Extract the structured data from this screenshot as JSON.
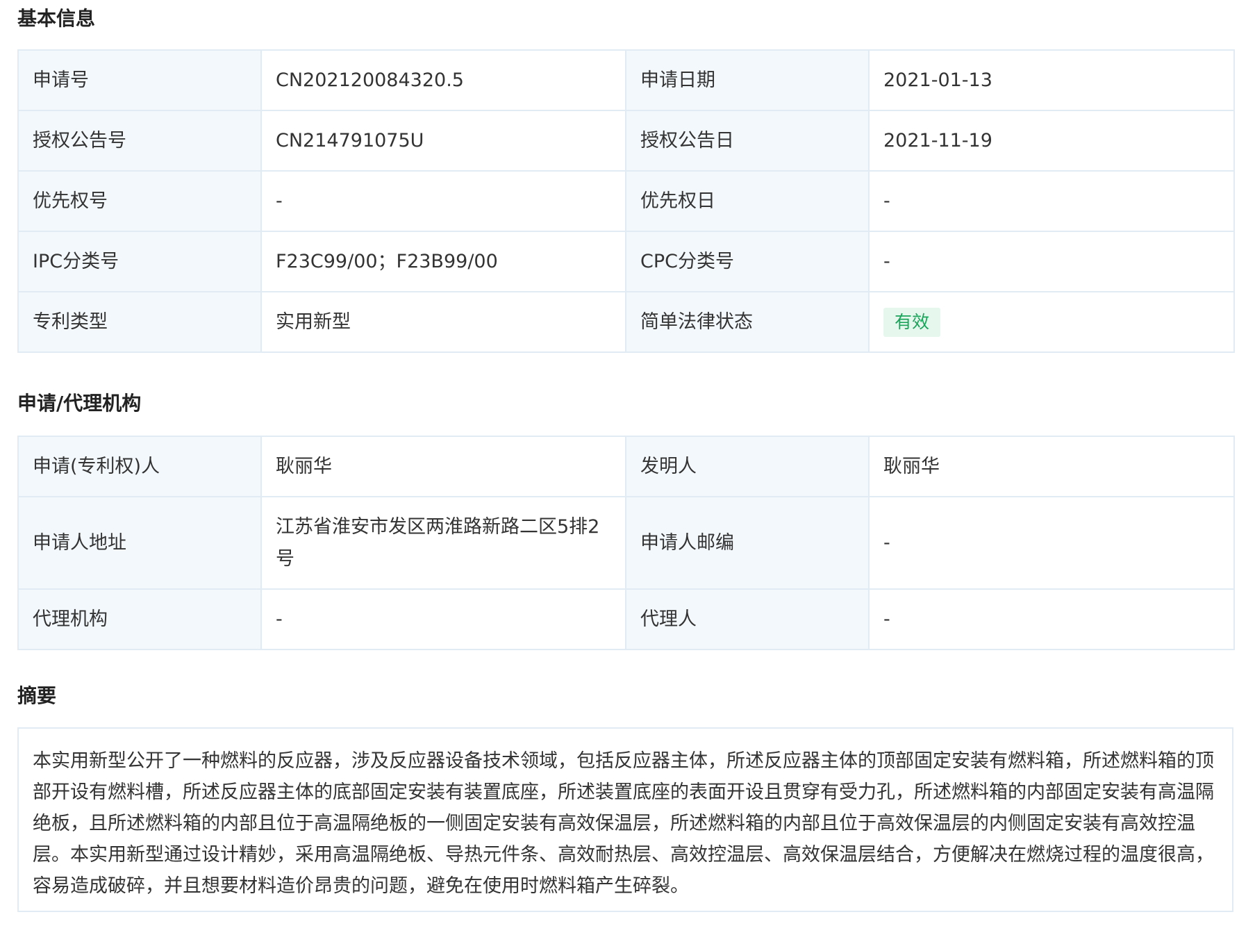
{
  "sections": {
    "basic": "基本信息",
    "agency": "申请/代理机构",
    "abstract": "摘要"
  },
  "basic": {
    "app_no_label": "申请号",
    "app_no": "CN202120084320.5",
    "app_date_label": "申请日期",
    "app_date": "2021-01-13",
    "grant_no_label": "授权公告号",
    "grant_no": "CN214791075U",
    "grant_date_label": "授权公告日",
    "grant_date": "2021-11-19",
    "priority_no_label": "优先权号",
    "priority_no": "-",
    "priority_date_label": "优先权日",
    "priority_date": "-",
    "ipc_label": "IPC分类号",
    "ipc": "F23C99/00；F23B99/00",
    "cpc_label": "CPC分类号",
    "cpc": "-",
    "type_label": "专利类型",
    "type": "实用新型",
    "legal_status_label": "简单法律状态",
    "legal_status": "有效",
    "legal_status_color": "#1aa55a"
  },
  "agency": {
    "applicant_label": "申请(专利权)人",
    "applicant": "耿丽华",
    "inventor_label": "发明人",
    "inventor": "耿丽华",
    "address_label": "申请人地址",
    "address": "江苏省淮安市发区两淮路新路二区5排2号",
    "postcode_label": "申请人邮编",
    "postcode": "-",
    "agency_label": "代理机构",
    "agency": "-",
    "agent_label": "代理人",
    "agent": "-"
  },
  "abstract": {
    "text": "本实用新型公开了一种燃料的反应器，涉及反应器设备技术领域，包括反应器主体，所述反应器主体的顶部固定安装有燃料箱，所述燃料箱的顶部开设有燃料槽，所述反应器主体的底部固定安装有装置底座，所述装置底座的表面开设且贯穿有受力孔，所述燃料箱的内部固定安装有高温隔绝板，且所述燃料箱的内部且位于高温隔绝板的一侧固定安装有高效保温层，所述燃料箱的内部且位于高效保温层的内侧固定安装有高效控温层。本实用新型通过设计精妙，采用高温隔绝板、导热元件条、高效耐热层、高效控温层、高效保温层结合，方便解决在燃烧过程的温度很高，容易造成破碎，并且想要材料造价昂贵的问题，避免在使用时燃料箱产生碎裂。"
  }
}
